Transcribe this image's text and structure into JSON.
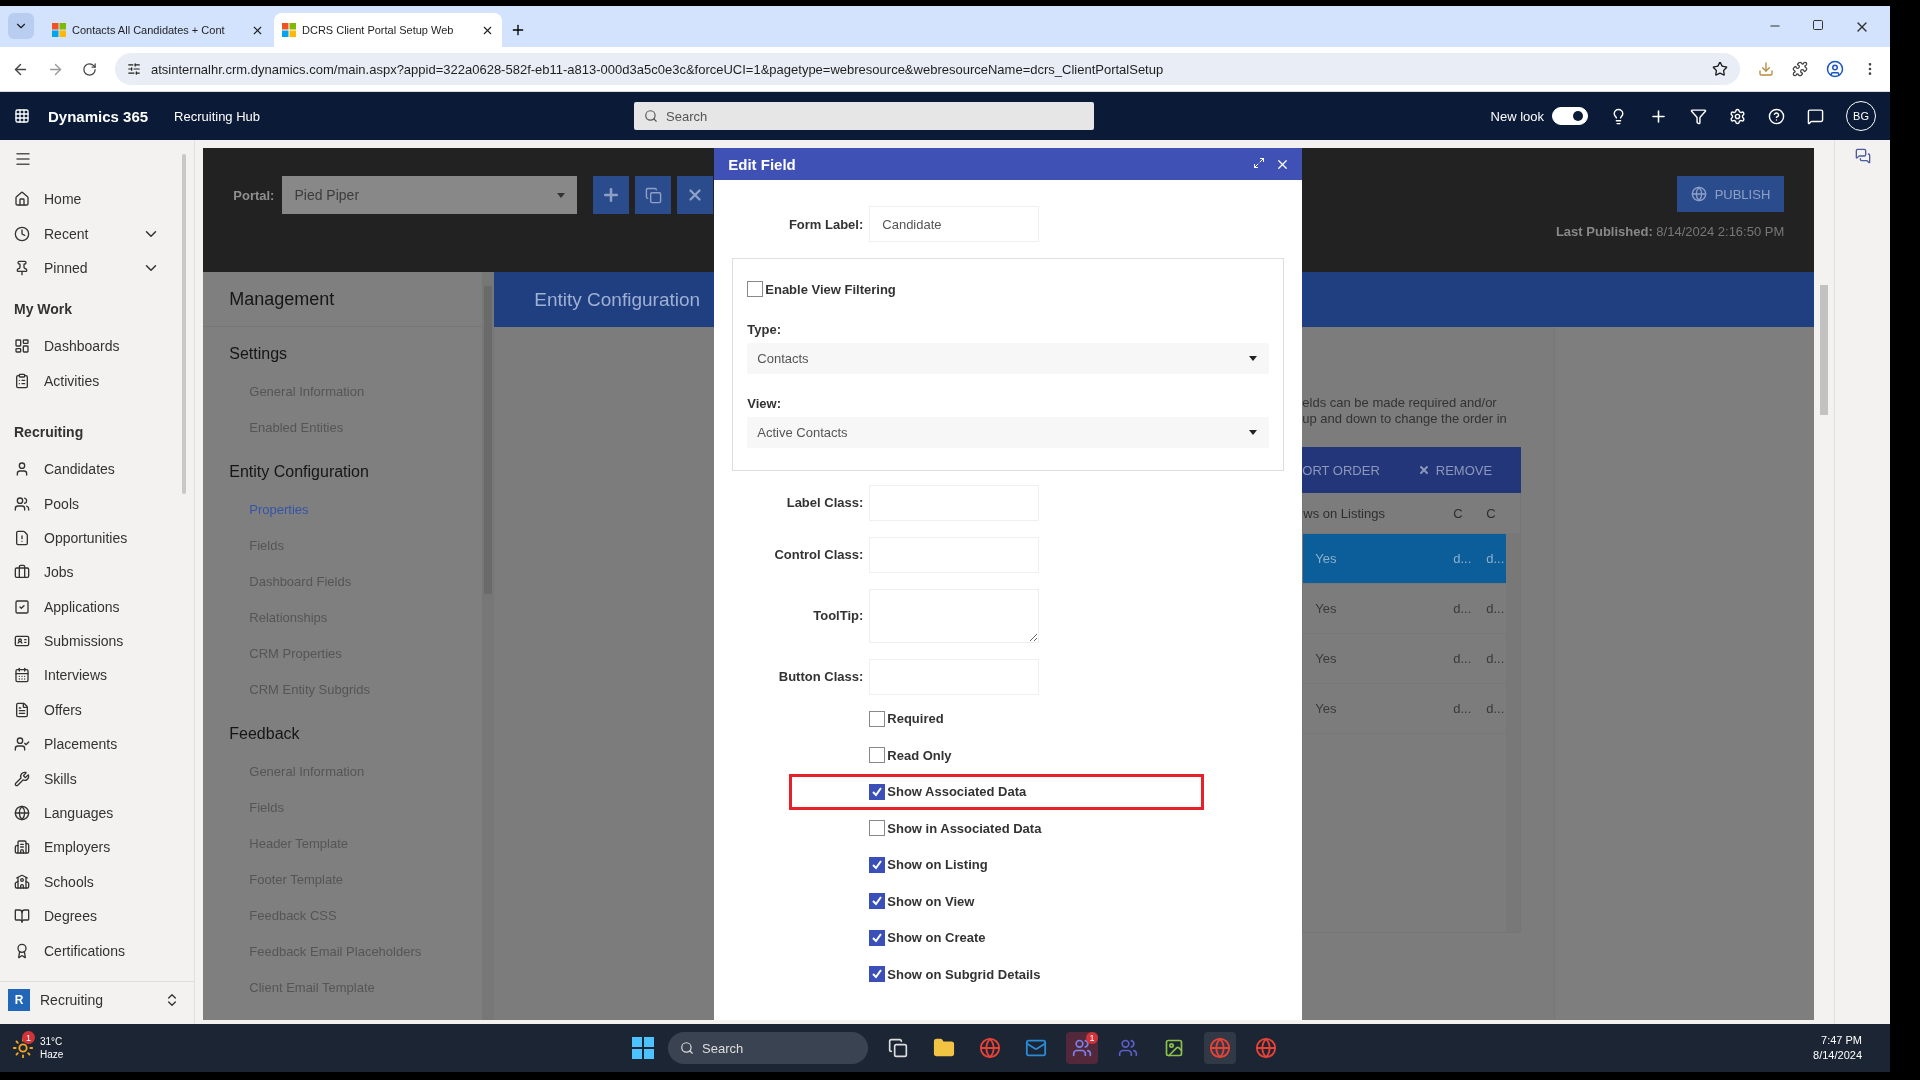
{
  "browser": {
    "tabs": [
      {
        "title": "Contacts All Candidates + Cont",
        "selected": false
      },
      {
        "title": "DCRS Client Portal Setup Web",
        "selected": true
      }
    ],
    "url": "atsinternalhr.crm.dynamics.com/main.aspx?appid=322a0628-582f-eb11-a813-000d3a5c0e3c&forceUCI=1&pagetype=webresource&webresourceName=dcrs_ClientPortalSetup"
  },
  "app_header": {
    "product": "Dynamics 365",
    "app": "Recruiting Hub",
    "search_placeholder": "Search",
    "new_look_label": "New look",
    "new_look_on": true,
    "avatar": "BG"
  },
  "nav": {
    "top_items": [
      {
        "label": "Home",
        "expandable": false
      },
      {
        "label": "Recent",
        "expandable": true
      },
      {
        "label": "Pinned",
        "expandable": true
      }
    ],
    "sections": [
      {
        "heading": "My Work",
        "items": [
          "Dashboards",
          "Activities"
        ]
      },
      {
        "heading": "Recruiting",
        "items": [
          "Candidates",
          "Pools",
          "Opportunities",
          "Jobs",
          "Applications",
          "Submissions",
          "Interviews",
          "Offers",
          "Placements",
          "Skills",
          "Languages",
          "Employers",
          "Schools",
          "Degrees",
          "Certifications"
        ]
      }
    ],
    "area_switcher": {
      "badge": "R",
      "label": "Recruiting"
    }
  },
  "portal": {
    "label": "Portal:",
    "value": "Pied Piper",
    "publish": "PUBLISH",
    "last_published_label": "Last Published:",
    "last_published": "8/14/2024 2:16:50 PM"
  },
  "management": {
    "title": "Management",
    "groups": [
      {
        "heading": "Settings",
        "items": [
          {
            "label": "General Information",
            "selected": false
          },
          {
            "label": "Enabled Entities",
            "selected": false
          }
        ]
      },
      {
        "heading": "Entity Configuration",
        "items": [
          {
            "label": "Properties",
            "selected": true
          },
          {
            "label": "Fields",
            "selected": false
          },
          {
            "label": "Dashboard Fields",
            "selected": false
          },
          {
            "label": "Relationships",
            "selected": false
          },
          {
            "label": "CRM Properties",
            "selected": false
          },
          {
            "label": "CRM Entity Subgrids",
            "selected": false
          }
        ]
      },
      {
        "heading": "Feedback",
        "items": [
          {
            "label": "General Information",
            "selected": false
          },
          {
            "label": "Fields",
            "selected": false
          },
          {
            "label": "Header Template",
            "selected": false
          },
          {
            "label": "Footer Template",
            "selected": false
          },
          {
            "label": "Feedback CSS",
            "selected": false
          },
          {
            "label": "Feedback Email Placeholders",
            "selected": false
          },
          {
            "label": "Client Email Template",
            "selected": false
          }
        ]
      }
    ]
  },
  "section_title": "Entity Configuration",
  "help_text": [
    "elds can be made required and/or",
    "up and down to change the order in"
  ],
  "grid": {
    "actions": [
      "ORT ORDER",
      "REMOVE"
    ],
    "columns": [
      "ws on Listings",
      "C",
      "C"
    ],
    "rows": [
      {
        "cells": [
          "Yes",
          "d...",
          "d..."
        ],
        "selected": true
      },
      {
        "cells": [
          "Yes",
          "d...",
          "d..."
        ],
        "selected": false
      },
      {
        "cells": [
          "Yes",
          "d...",
          "d..."
        ],
        "selected": false
      },
      {
        "cells": [
          "Yes",
          "d...",
          "d..."
        ],
        "selected": false
      }
    ]
  },
  "dialog": {
    "title": "Edit Field",
    "form_label": {
      "label": "Form Label:",
      "value": "Candidate"
    },
    "enable_view_filtering": {
      "label": "Enable View Filtering",
      "checked": false
    },
    "type": {
      "label": "Type:",
      "value": "Contacts"
    },
    "view": {
      "label": "View:",
      "value": "Active Contacts"
    },
    "text_fields": [
      {
        "label": "Label Class:",
        "kind": "input"
      },
      {
        "label": "Control Class:",
        "kind": "input"
      },
      {
        "label": "ToolTip:",
        "kind": "textarea"
      },
      {
        "label": "Button Class:",
        "kind": "input"
      }
    ],
    "checkboxes": [
      {
        "label": "Required",
        "checked": false,
        "highlighted": false
      },
      {
        "label": "Read Only",
        "checked": false,
        "highlighted": false
      },
      {
        "label": "Show Associated Data",
        "checked": true,
        "highlighted": true
      },
      {
        "label": "Show in Associated Data",
        "checked": false,
        "highlighted": false
      },
      {
        "label": "Show on Listing",
        "checked": true,
        "highlighted": false
      },
      {
        "label": "Show on View",
        "checked": true,
        "highlighted": false
      },
      {
        "label": "Show on Create",
        "checked": true,
        "highlighted": false
      },
      {
        "label": "Show on Subgrid Details",
        "checked": true,
        "highlighted": false
      }
    ]
  },
  "taskbar": {
    "weather_badge": "1",
    "temperature": "31°C",
    "condition": "Haze",
    "search_placeholder": "Search",
    "app_badge": "1",
    "time": "7:47 PM",
    "date": "8/14/2024"
  }
}
